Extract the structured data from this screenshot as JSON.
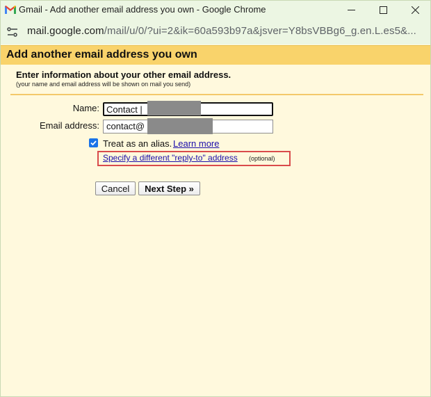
{
  "window": {
    "title": "Gmail - Add another email address you own - Google Chrome"
  },
  "addressbar": {
    "url_host": "mail.google.com",
    "url_path": "/mail/u/0/?ui=2&ik=60a593b97a&jsver=Y8bsVBBg6_g.en.L.es5&..."
  },
  "dialog": {
    "title": "Add another email address you own",
    "intro_title": "Enter information about your other email address.",
    "intro_sub": "(your name and email address will be shown on mail you send)",
    "name_label": "Name:",
    "name_value": "Contact |",
    "email_label": "Email address:",
    "email_value": "contact@",
    "alias_label": "Treat as an alias.",
    "alias_checked": true,
    "learn_more": "Learn more",
    "reply_to_link": "Specify a different \"reply-to\" address",
    "optional": "(optional)",
    "cancel_label": "Cancel",
    "next_label": "Next Step »"
  },
  "colors": {
    "header_bg": "#f9d36b",
    "content_bg": "#fff9dd",
    "titlebar_bg": "#ecf6e3",
    "link": "#1a0dab",
    "highlight_box": "#d94b4b",
    "checkbox": "#1a73e8"
  },
  "icons": [
    "gmail-logo-icon",
    "site-info-icon",
    "minimize-icon",
    "maximize-icon",
    "close-icon",
    "checkmark-icon"
  ]
}
